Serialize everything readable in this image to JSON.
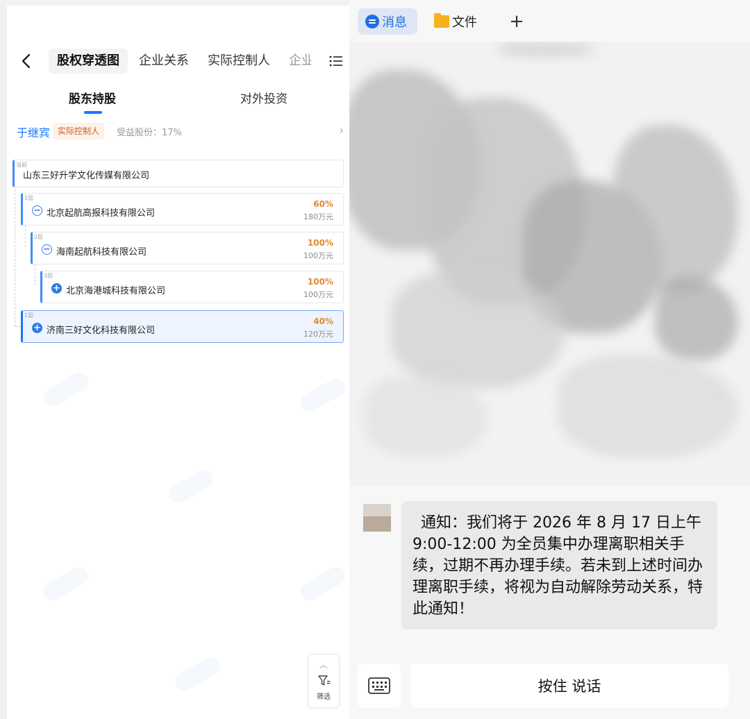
{
  "left": {
    "nav": {
      "tabs": [
        {
          "label": "股权穿透图"
        },
        {
          "label": "企业关系"
        },
        {
          "label": "实际控制人"
        },
        {
          "label": "企业"
        }
      ]
    },
    "sub_tabs": [
      {
        "label": "股东持股"
      },
      {
        "label": "对外投资"
      }
    ],
    "controller": {
      "name": "于继宾",
      "tag": "实际控制人",
      "share": "受益股份：17%"
    },
    "tree": [
      {
        "level": "当前",
        "name": "山东三好升学文化传媒有限公司",
        "percent": "",
        "amount": ""
      },
      {
        "level": "1层",
        "name": "北京起航高报科技有限公司",
        "percent": "60%",
        "amount": "180万元"
      },
      {
        "level": "2层",
        "name": "海南起航科技有限公司",
        "percent": "100%",
        "amount": "100万元"
      },
      {
        "level": "3层",
        "name": "北京海港城科技有限公司",
        "percent": "100%",
        "amount": "100万元"
      },
      {
        "level": "1层",
        "name": "济南三好文化科技有限公司",
        "percent": "40%",
        "amount": "120万元"
      }
    ],
    "filter_label": "筛选"
  },
  "right": {
    "tabs": {
      "messages": "消息",
      "files": "文件",
      "add": "+"
    },
    "message": "通知：我们将于 2026 年 8 月 17 日上午 9:00-12:00 为全员集中办理离职相关手续，过期不再办理手续。若未到上述时间办理离职手续，将视为自动解除劳动关系，特此通知！",
    "hold_to_talk": "按住 说话"
  },
  "colors": {
    "accent": "#1677ff",
    "percent": "#e08a2e",
    "tag_text": "#c8602e",
    "tag_bg": "#fdf1e8",
    "bubble_bg": "#e9e9eb"
  }
}
